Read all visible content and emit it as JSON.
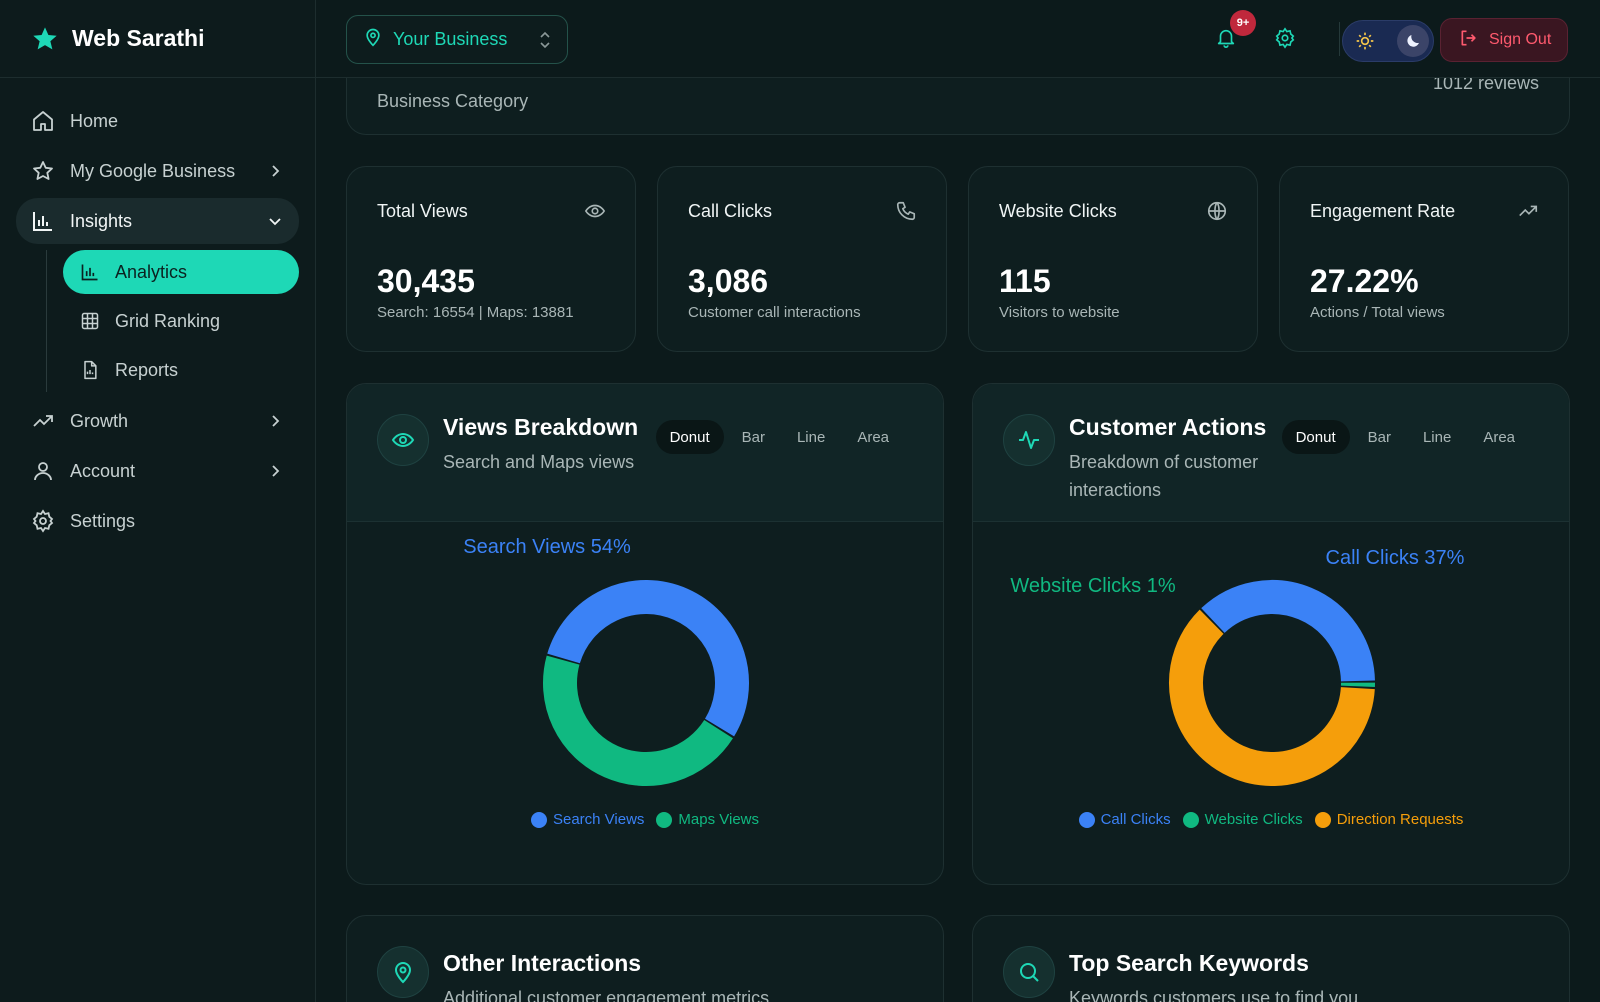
{
  "brand": {
    "name": "Web Sarathi"
  },
  "sidebar": {
    "items": [
      {
        "label": "Home"
      },
      {
        "label": "My Google Business"
      },
      {
        "label": "Insights"
      },
      {
        "label": "Growth"
      },
      {
        "label": "Account"
      },
      {
        "label": "Settings"
      }
    ],
    "insights_sub": [
      {
        "label": "Analytics"
      },
      {
        "label": "Grid Ranking"
      },
      {
        "label": "Reports"
      }
    ]
  },
  "topbar": {
    "business_select": "Your Business",
    "notification_badge": "9+",
    "sign_out": "Sign Out"
  },
  "business_card": {
    "category": "Business Category",
    "reviews": "1012 reviews"
  },
  "stats": [
    {
      "title": "Total Views",
      "value": "30,435",
      "sub": "Search: 16554 | Maps: 13881",
      "icon": "eye-icon"
    },
    {
      "title": "Call Clicks",
      "value": "3,086",
      "sub": "Customer call interactions",
      "icon": "phone-icon"
    },
    {
      "title": "Website Clicks",
      "value": "115",
      "sub": "Visitors to website",
      "icon": "globe-icon"
    },
    {
      "title": "Engagement Rate",
      "value": "27.22%",
      "sub": "Actions / Total views",
      "icon": "trending-up-icon"
    }
  ],
  "views_breakdown": {
    "title": "Views Breakdown",
    "subtitle": "Search and Maps views",
    "tabs": [
      "Donut",
      "Bar",
      "Line",
      "Area"
    ],
    "active_tab": "Donut",
    "callout": "Search Views 54%"
  },
  "customer_actions": {
    "title": "Customer Actions",
    "subtitle": "Breakdown of customer interactions",
    "tabs": [
      "Donut",
      "Bar",
      "Line",
      "Area"
    ],
    "active_tab": "Donut",
    "callouts": [
      "Call Clicks 37%",
      "Website Clicks 1%"
    ]
  },
  "other_interactions": {
    "title": "Other Interactions",
    "subtitle": "Additional customer engagement metrics"
  },
  "top_keywords": {
    "title": "Top Search Keywords",
    "subtitle": "Keywords customers use to find you"
  },
  "colors": {
    "accent": "#1ed8b6",
    "blue": "#3b82f6",
    "green": "#10b981",
    "orange": "#f59e0b"
  },
  "chart_data": [
    {
      "type": "pie",
      "categories": [
        "Search Views",
        "Maps Views"
      ],
      "values": [
        16554,
        13881
      ],
      "colors": [
        "#3b82f6",
        "#10b981"
      ]
    },
    {
      "type": "pie",
      "categories": [
        "Call Clicks",
        "Website Clicks",
        "Direction Requests"
      ],
      "values": [
        37,
        1,
        62
      ],
      "colors": [
        "#3b82f6",
        "#10b981",
        "#f59e0b"
      ]
    }
  ]
}
